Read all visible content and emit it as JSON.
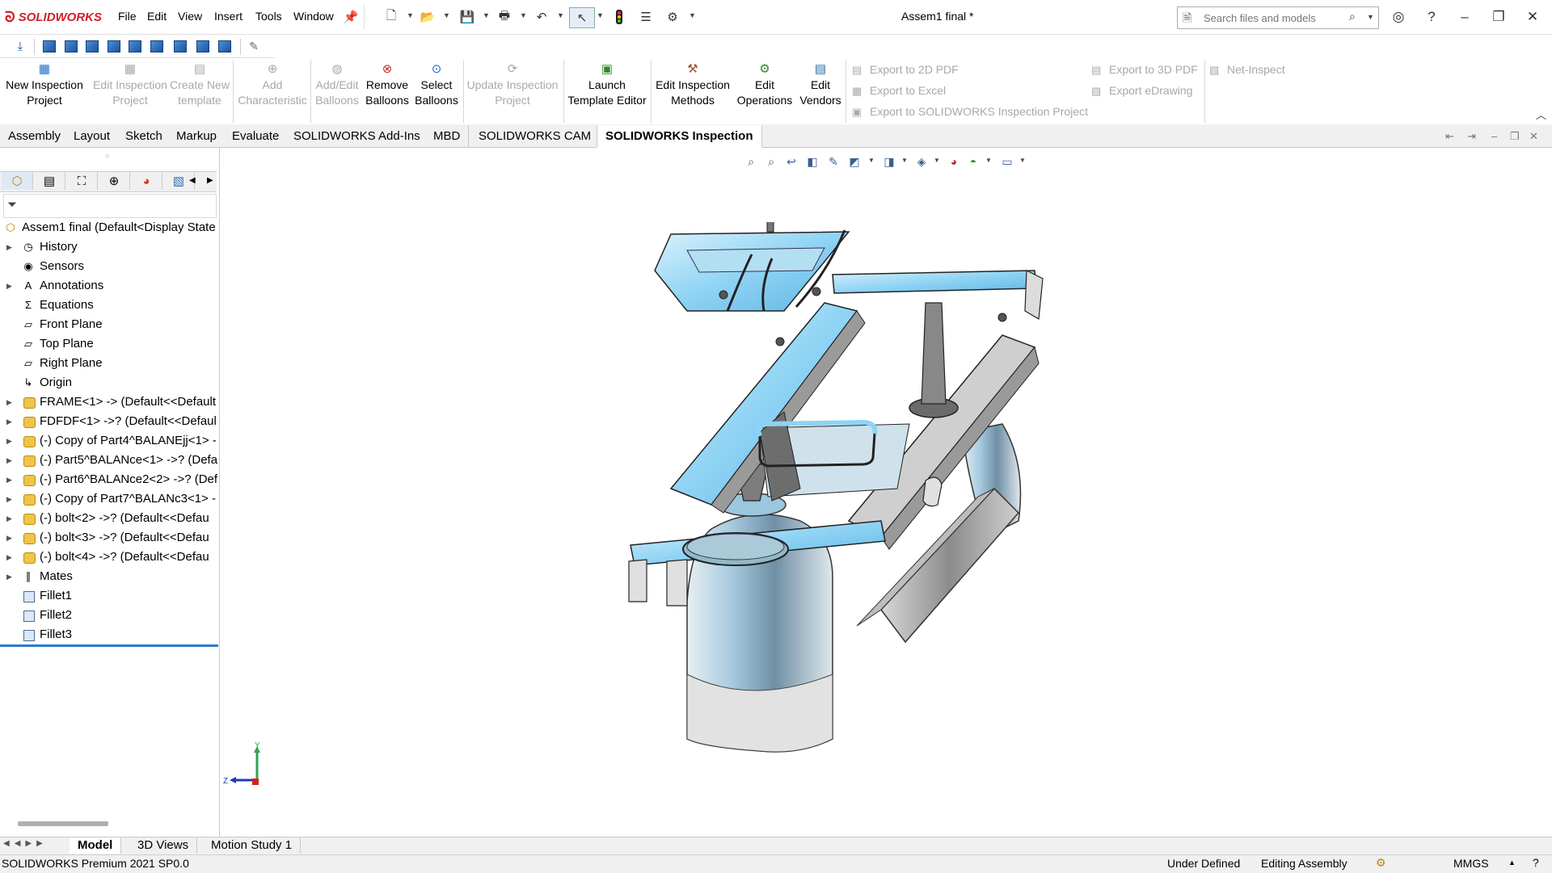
{
  "app": {
    "brand": "SOLIDWORKS",
    "document_title": "Assem1 final *"
  },
  "menu": [
    "File",
    "Edit",
    "View",
    "Insert",
    "Tools",
    "Window"
  ],
  "search": {
    "placeholder": "Search files and models"
  },
  "command_manager": {
    "items": [
      {
        "label_line1": "New Inspection",
        "label_line2": "Project",
        "enabled": true
      },
      {
        "label_line1": "Edit Inspection",
        "label_line2": "Project",
        "enabled": false
      },
      {
        "label_line1": "Create New",
        "label_line2": "template",
        "enabled": false
      },
      {
        "label_line1": "Add",
        "label_line2": "Characteristic",
        "enabled": false
      },
      {
        "label_line1": "Add/Edit",
        "label_line2": "Balloons",
        "enabled": false
      },
      {
        "label_line1": "Remove",
        "label_line2": "Balloons",
        "enabled": true
      },
      {
        "label_line1": "Select",
        "label_line2": "Balloons",
        "enabled": true
      },
      {
        "label_line1": "Update Inspection",
        "label_line2": "Project",
        "enabled": false
      },
      {
        "label_line1": "Launch",
        "label_line2": "Template Editor",
        "enabled": true
      },
      {
        "label_line1": "Edit Inspection",
        "label_line2": "Methods",
        "enabled": true
      },
      {
        "label_line1": "Edit",
        "label_line2": "Operations",
        "enabled": true
      },
      {
        "label_line1": "Edit",
        "label_line2": "Vendors",
        "enabled": true
      }
    ],
    "export_items": [
      "Export to 2D PDF",
      "Export to Excel",
      "Export to SOLIDWORKS Inspection Project"
    ],
    "export_items_2": [
      "Export to 3D PDF",
      "Export eDrawing"
    ],
    "net_inspect": "Net-Inspect"
  },
  "tabs": [
    "Assembly",
    "Layout",
    "Sketch",
    "Markup",
    "Evaluate",
    "SOLIDWORKS Add-Ins",
    "MBD",
    "SOLIDWORKS CAM",
    "SOLIDWORKS Inspection"
  ],
  "active_tab": "SOLIDWORKS Inspection",
  "tree": {
    "root": "Assem1 final  (Default<Display State",
    "items": [
      {
        "label": "History",
        "icon": "history-icon",
        "expandable": true
      },
      {
        "label": "Sensors",
        "icon": "sensor-icon",
        "expandable": false
      },
      {
        "label": "Annotations",
        "icon": "annotation-icon",
        "expandable": true
      },
      {
        "label": "Equations",
        "icon": "equation-icon",
        "expandable": false
      },
      {
        "label": "Front Plane",
        "icon": "plane-icon",
        "expandable": false
      },
      {
        "label": "Top Plane",
        "icon": "plane-icon",
        "expandable": false
      },
      {
        "label": "Right Plane",
        "icon": "plane-icon",
        "expandable": false
      },
      {
        "label": "Origin",
        "icon": "origin-icon",
        "expandable": false
      },
      {
        "label": "FRAME<1> -> (Default<<Default",
        "icon": "part-icon",
        "expandable": true
      },
      {
        "label": "FDFDF<1> ->? (Default<<Defaul",
        "icon": "part-icon",
        "expandable": true
      },
      {
        "label": "(-) Copy of Part4^BALANEjj<1> -",
        "icon": "part-icon",
        "expandable": true
      },
      {
        "label": "(-) Part5^BALANce<1> ->? (Defa",
        "icon": "part-icon",
        "expandable": true
      },
      {
        "label": "(-) Part6^BALANce2<2> ->? (Def",
        "icon": "part-icon",
        "expandable": true
      },
      {
        "label": "(-) Copy of Part7^BALANc3<1> -",
        "icon": "part-icon",
        "expandable": true
      },
      {
        "label": "(-) bolt<2> ->? (Default<<Defau",
        "icon": "part-icon",
        "expandable": true
      },
      {
        "label": "(-) bolt<3> ->? (Default<<Defau",
        "icon": "part-icon",
        "expandable": true
      },
      {
        "label": "(-) bolt<4> ->? (Default<<Defau",
        "icon": "part-icon",
        "expandable": true
      },
      {
        "label": "Mates",
        "icon": "mates-icon",
        "expandable": true
      },
      {
        "label": "Fillet1",
        "icon": "fillet-icon",
        "expandable": false
      },
      {
        "label": "Fillet2",
        "icon": "fillet-icon",
        "expandable": false
      },
      {
        "label": "Fillet3",
        "icon": "fillet-icon",
        "expandable": false
      }
    ]
  },
  "bottom_tabs": [
    "Model",
    "3D Views",
    "Motion Study 1"
  ],
  "active_bottom_tab": "Model",
  "status": {
    "product": "SOLIDWORKS Premium 2021 SP0.0",
    "state": "Under Defined",
    "mode": "Editing Assembly",
    "units": "MMGS"
  },
  "triad": {
    "y": "Y",
    "z": "Z"
  },
  "colors": {
    "accent": "#2c7bd0",
    "brand": "#d0202a",
    "model_blue": "#8fd3f4"
  }
}
